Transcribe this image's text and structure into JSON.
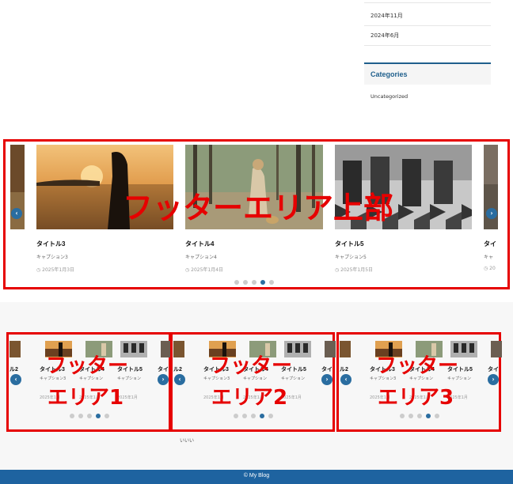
{
  "sidebar": {
    "archives": [
      "2024年11月",
      "2024年6月"
    ],
    "categories_title": "Categories",
    "categories": [
      "Uncategorized"
    ]
  },
  "footer_top": {
    "overlay": "フッターエリア上部",
    "slides": [
      {
        "title": "タイトル3",
        "caption": "キャプション3",
        "date": "2025年1月3日"
      },
      {
        "title": "タイトル4",
        "caption": "キャプション4",
        "date": "2025年1月4日"
      },
      {
        "title": "タイトル5",
        "caption": "キャプション5",
        "date": "2025年1月5日"
      },
      {
        "title": "タイ",
        "caption": "キャ",
        "date": "20"
      }
    ],
    "prev_icon": "‹",
    "next_icon": "›"
  },
  "footer_areas": [
    {
      "overlay_line1": "フッター",
      "overlay_line2": "エリア1",
      "titles": [
        "ル2",
        "タイトル3",
        "タイトル4",
        "タイトル5",
        "タイ"
      ],
      "captions": [
        "キャプション3",
        "キャプション",
        "キャプション"
      ],
      "dates": [
        "2025年1月",
        "2025年1月",
        "2025年1月"
      ]
    },
    {
      "overlay_line1": "フッター",
      "overlay_line2": "エリア2",
      "titles": [
        "ル2",
        "タイトル3",
        "タイトル4",
        "タイトル5",
        "タイ"
      ],
      "captions": [
        "キャプション3",
        "キャプション",
        "キャプション"
      ],
      "dates": [
        "2025年1月",
        "2025年1月",
        "2025年1月"
      ]
    },
    {
      "overlay_line1": "フッター",
      "overlay_line2": "エリア3",
      "titles": [
        "ル2",
        "タイトル3",
        "タイトル4",
        "タイトル5",
        "タイ"
      ],
      "captions": [
        "キャプション3",
        "キャプション",
        "キャプション"
      ],
      "dates": [
        "2025年1月",
        "2025年1月",
        "2025年1月"
      ]
    }
  ],
  "footer_text": "いいい",
  "copyright": "© My Blog",
  "colors": {
    "accent": "#1e63a0",
    "highlight": "#e60000"
  }
}
